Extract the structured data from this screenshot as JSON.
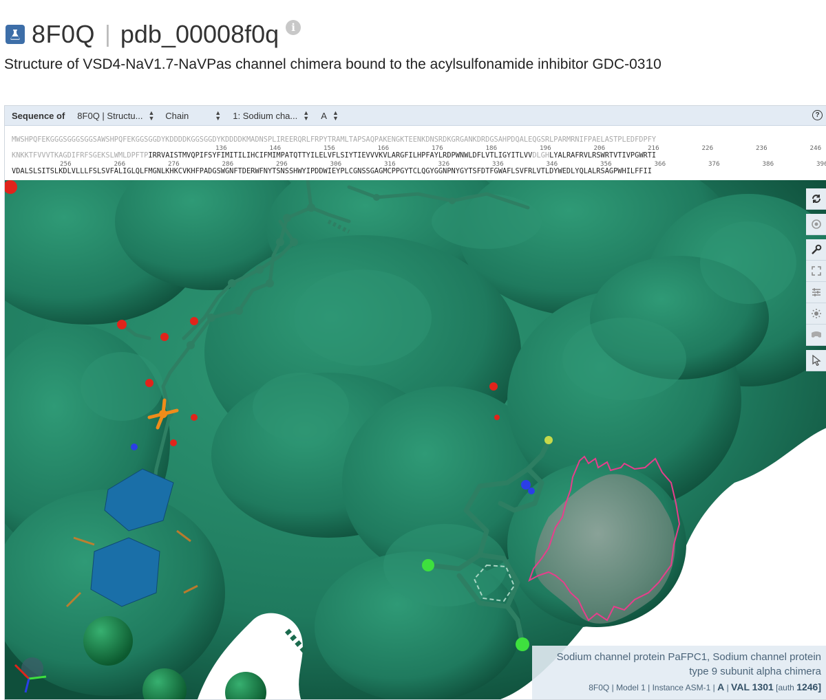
{
  "header": {
    "pdb_id": "8F0Q",
    "entry_id": "pdb_00008f0q",
    "info_icon": "i",
    "subtitle": "Structure of VSD4-NaV1.7-NaVPas channel chimera bound to the acylsulfonamide inhibitor GDC-0310"
  },
  "sequence_bar": {
    "label": "Sequence of",
    "structure_select": "8F0Q | Structu...",
    "mode_select": "Chain",
    "entity_select": "1: Sodium cha...",
    "chain_select": "A",
    "help": "?"
  },
  "sequence": {
    "line1_gray": "MWSHPQFEKGGGSGGGSGGSAWSHPQFEKGGSGGDYKDDDDKGGSGGDYKDDDDKMADNSPLIREERQRLFRPYTRAMLTAPSAQPAKENGKTEENKDNSRDKGRGANKDRDGSAHPDQALEQGSRLPARMRNIFPAELASTPLEDFDPFY",
    "line2_gray": "KNKKTFVVVTKAGDIFRFSGEKSLWMLDPFTP",
    "line2_dark_a": "IRRVAISTMVQPIFSYFIMITILIHCIFMIMPATQTTYILELVFLSIYTIEVVVKVLARGFILHPFAYLRDPWNWLDFLVTLIGYITLVV",
    "line2_gray_b": "DLGH",
    "line2_dark_b": "LYALRAFRVLRSWRTVTIVPGWRTI",
    "line3_dark": "VDALSLSITSLKDLVLLLFSLSVFALIGLQLFMGNLKHKCVKHFPADGSWGNFTDERWFNYTSNSSHWYIPDDWIEYPLCGNSSGAGMCPPGYTCLQGYGGNPNYGYTSFDTFGWAFLSVFRLVTLDYWEDLYQLALRSAGPWHILFFII",
    "numbers_row2": [
      "136",
      "146",
      "156",
      "166",
      "176",
      "186",
      "196",
      "206",
      "216",
      "226",
      "236",
      "246"
    ],
    "numbers_row3": [
      "256",
      "266",
      "276",
      "286",
      "296",
      "306",
      "316",
      "326",
      "336",
      "346",
      "356",
      "366",
      "376",
      "386",
      "396"
    ]
  },
  "toolbar": {
    "icons": [
      "reset-camera-icon",
      "screenshot-icon",
      "controls-icon",
      "expand-icon",
      "settings-icon",
      "lighting-icon",
      "vr-icon",
      "selection-mode-icon"
    ]
  },
  "info_box": {
    "line1": "Sodium channel protein PaFPC1, Sodium channel protein",
    "line2": "type 9 subunit alpha chimera",
    "id": "8F0Q",
    "model": "Model 1",
    "instance": "Instance ASM-1",
    "chain": "A",
    "residue": "VAL 1301",
    "auth_label": "[auth",
    "auth_num": "1246]",
    "sep": "|"
  },
  "colors": {
    "surface": "#1f7a5e",
    "surface_light": "#2f9a76",
    "pocket_outline": "#e83e8c",
    "carbon": "#2e7f63",
    "oxygen": "#e0241b",
    "nitrogen": "#2b3ee6",
    "phosphorus": "#f08c1a",
    "chlorine": "#3ee03e",
    "sugar": "#1a6fa8",
    "ion": "#1d8a4a"
  }
}
